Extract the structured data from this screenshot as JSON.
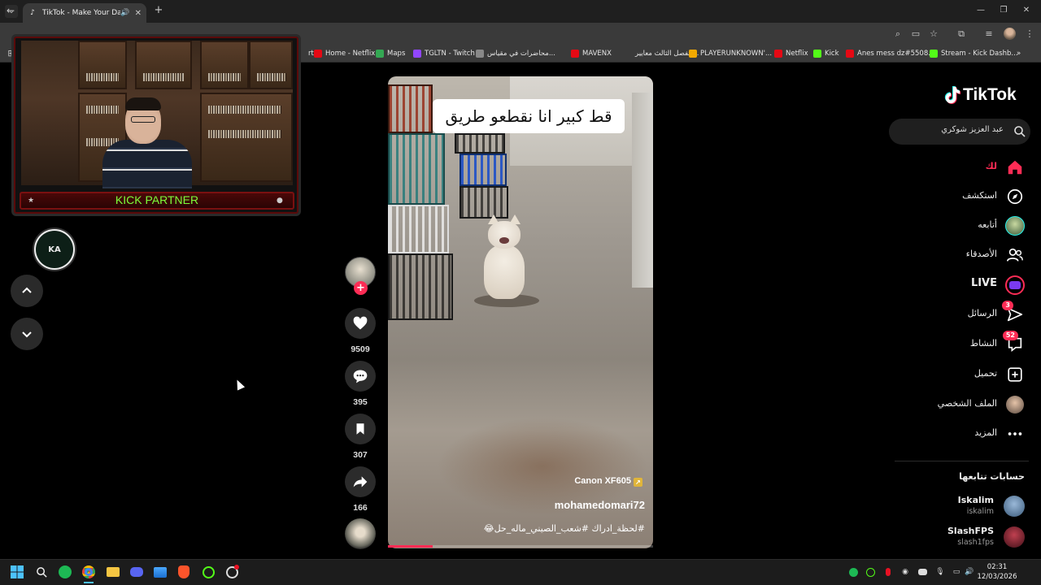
{
  "browser": {
    "tab_title": "TikTok - Make Your Day",
    "tab_close": "✕",
    "new_tab": "+",
    "window_controls": [
      "—",
      "❐",
      "✕"
    ]
  },
  "bookmarks": [
    {
      "label": "rt",
      "color": "#3a3a3a"
    },
    {
      "label": "Home - Netflix",
      "color": "#e50914"
    },
    {
      "label": "Maps",
      "color": "#34a853"
    },
    {
      "label": "TGLTN - Twitch",
      "color": "#9146ff"
    },
    {
      "label": "محاضرات في مقياس...",
      "color": "#888888"
    },
    {
      "label": "MAVENX",
      "color": "#e50914"
    },
    {
      "label": "الفصل الثالث معايير...",
      "color": "#3a3a3a"
    },
    {
      "label": "PLAYERUNKNOWN'...",
      "color": "#f2a900"
    },
    {
      "label": "Netflix",
      "color": "#e50914"
    },
    {
      "label": "Kick",
      "color": "#53fc18"
    },
    {
      "label": "Anes mess dz#5508...",
      "color": "#e50914"
    },
    {
      "label": "Stream - Kick Dashb...",
      "color": "#53fc18"
    }
  ],
  "overlay": {
    "kick_partner": "KICK PARTNER",
    "logo_text": "KA"
  },
  "video": {
    "caption": "قط كبير انا نقطعو طريق",
    "camera_label": "Canon XF605",
    "author": "mohamedomari72",
    "description": "#لحظة_ادراك #شعب_الصيني_ماله_حل😂",
    "progress_fraction": 0.17
  },
  "actions": {
    "likes": "9509",
    "comments": "395",
    "saves": "307",
    "shares": "166"
  },
  "sidebar": {
    "logo": "TikTok",
    "search_text": "عبد العزيز شوكري",
    "nav": [
      {
        "label": "لك",
        "icon": "home-icon",
        "active": true
      },
      {
        "label": "استكشف",
        "icon": "compass-icon"
      },
      {
        "label": "أتابعه",
        "icon": "following-avatar-icon"
      },
      {
        "label": "الأصدقاء",
        "icon": "friends-icon"
      },
      {
        "label": "LIVE",
        "icon": "live-icon"
      },
      {
        "label": "الرسائل",
        "icon": "messages-icon",
        "badge": "3"
      },
      {
        "label": "النشاط",
        "icon": "activity-icon",
        "badge": "52"
      },
      {
        "label": "تحميل",
        "icon": "upload-icon"
      },
      {
        "label": "الملف الشخصي",
        "icon": "profile-icon"
      },
      {
        "label": "المزيد",
        "icon": "more-icon"
      }
    ],
    "following_title": "حسابات تتابعها",
    "accounts": [
      {
        "name": "Iskalim",
        "handle": "iskalim"
      },
      {
        "name": "SlashFPS",
        "handle": "slash1fps"
      }
    ]
  },
  "taskbar": {
    "time": "02:31",
    "date": "12/03/2026"
  },
  "colors": {
    "accent": "#fe2c55",
    "kick_green": "#7dff3a"
  }
}
